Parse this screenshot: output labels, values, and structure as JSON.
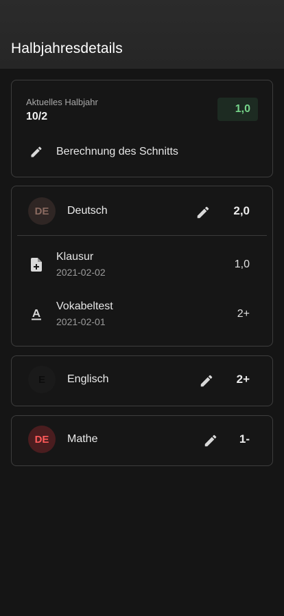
{
  "appbar": {
    "title": "Halbjahresdetails"
  },
  "summary": {
    "label": "Aktuelles Halbjahr",
    "value": "10/2",
    "average": "1,0",
    "average_color": "#76d48a",
    "calc_label": "Berechnung des Schnitts",
    "calc_icon": "pencil-icon"
  },
  "subjects": [
    {
      "abbr": "DE",
      "name": "Deutsch",
      "grade": "2,0",
      "avatar_bg": "#2f2624",
      "avatar_fg": "#8a6a60",
      "exams": [
        {
          "title": "Klausur",
          "date": "2021-02-02",
          "grade": "1,0",
          "icon": "file-plus-icon"
        },
        {
          "title": "Vokabeltest",
          "date": "2021-02-01",
          "grade": "2+",
          "icon": "text-format-icon"
        }
      ]
    },
    {
      "abbr": "E",
      "name": "Englisch",
      "grade": "2+",
      "avatar_bg": "#1a1a1a",
      "avatar_fg": "#0c0c0c"
    },
    {
      "abbr": "DE",
      "name": "Mathe",
      "grade": "1-",
      "avatar_bg": "#4a1d1f",
      "avatar_fg": "#ff5a5a"
    }
  ]
}
